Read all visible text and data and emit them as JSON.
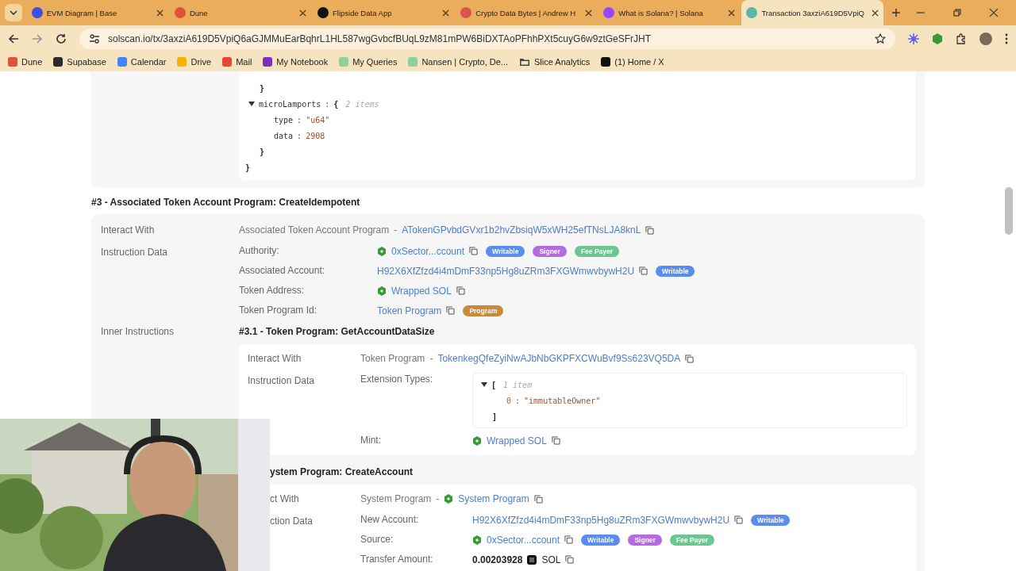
{
  "browser": {
    "tabs": [
      {
        "title": "EVM Diagram | Base",
        "selected": false,
        "color": "#3b4fe0"
      },
      {
        "title": "Dune",
        "selected": false,
        "color": "#e0533a"
      },
      {
        "title": "Flipside Data App",
        "selected": false,
        "color": "#111111"
      },
      {
        "title": "Crypto Data Bytes | Andrew H",
        "selected": false,
        "color": "#d9534f"
      },
      {
        "title": "What is Solana? | Solana",
        "selected": false,
        "color": "#9945ff"
      },
      {
        "title": "Transaction 3axziA619D5VpiQ",
        "selected": true,
        "color": "#5fb3a8"
      }
    ],
    "url": "solscan.io/tx/3axziA619D5VpiQ6aGJMMuEarBqhrL1HL587wgGvbcfBUqL9zM81mPW6BiDXTAoPFhhPXt5cuyG6w9ztGeSFrJHT",
    "bookmarks": [
      {
        "label": "Dune",
        "kind": "site",
        "color": "#e0533a"
      },
      {
        "label": "Supabase",
        "kind": "site",
        "color": "#2b2b2b"
      },
      {
        "label": "Calendar",
        "kind": "site",
        "color": "#4285f4"
      },
      {
        "label": "Drive",
        "kind": "site",
        "color": "#f4b400"
      },
      {
        "label": "Mail",
        "kind": "site",
        "color": "#ea4335"
      },
      {
        "label": "My Notebook",
        "kind": "site",
        "color": "#7b2fbf"
      },
      {
        "label": "My Queries",
        "kind": "site",
        "color": "#8fd19e"
      },
      {
        "label": "Nansen | Crypto, De...",
        "kind": "site",
        "color": "#8fd19e"
      },
      {
        "label": "Slice Analytics",
        "kind": "folder",
        "color": "#444444"
      },
      {
        "label": "(1) Home / X",
        "kind": "site",
        "color": "#111111"
      }
    ]
  },
  "code_tail": {
    "close": "}",
    "children": [
      {
        "close": "}"
      },
      {
        "key": "microLamports",
        "separator": ":",
        "open": "{",
        "close": "}",
        "count": "2 items",
        "expanded": true,
        "children": [
          {
            "key": "type",
            "separator": ":",
            "value": "\"u64\""
          },
          {
            "key": "data",
            "separator": ":",
            "value": "2908"
          }
        ]
      }
    ]
  },
  "section": {
    "title": "#3 - Associated Token Account Program: CreateIdempotent",
    "interact": {
      "label": "Interact With",
      "program": "Associated Token Account Program",
      "dash": "-",
      "address": "ATokenGPvbdGVxr1b2hvZbsiqW5xWH25efTNsLJA8knL",
      "verified": false
    },
    "data_label": "Instruction Data",
    "fields": [
      {
        "label": "Authority:",
        "kind": "link",
        "value": "0xSector...ccount",
        "verified": true,
        "badges": [
          {
            "label": "Writable",
            "color": "#5b8def"
          },
          {
            "label": "Signer",
            "color": "#b46ae0"
          },
          {
            "label": "Fee Payer",
            "color": "#6cc592"
          }
        ]
      },
      {
        "label": "Associated Account:",
        "kind": "link",
        "value": "H92X6XfZfzd4i4mDmF33np5Hg8uZRm3FXGWmwvbywH2U",
        "verified": false,
        "badges": [
          {
            "label": "Writable",
            "color": "#5b8def"
          }
        ]
      },
      {
        "label": "Token Address:",
        "kind": "link",
        "value": "Wrapped SOL",
        "verified": true
      },
      {
        "label": "Token Program Id:",
        "kind": "link",
        "value": "Token Program",
        "verified": false,
        "badges": [
          {
            "label": "Program",
            "color": "#c98a3a"
          }
        ]
      }
    ],
    "inner_label": "Inner Instructions",
    "inner": [
      {
        "title": "#3.1 - Token Program: GetAccountDataSize",
        "interact": {
          "label": "Interact With",
          "program": "Token Program",
          "dash": "-",
          "address": "TokenkegQfeZyiNwAJbNbGKPFXCWuBvf9Ss623VQ5DA",
          "verified": false
        },
        "data_label": "Instruction Data",
        "fields": [
          {
            "label": "Extension Types:",
            "kind": "json",
            "tree": {
              "open": "[",
              "close": "]",
              "count": "1 item",
              "expanded": true,
              "children": [
                {
                  "key": "0",
                  "separator": ":",
                  "value": "\"immutableOwner\""
                }
              ]
            }
          },
          {
            "label": "Mint:",
            "kind": "link",
            "value": "Wrapped SOL",
            "verified": true
          }
        ]
      },
      {
        "title": "ystem Program: CreateAccount",
        "interact": {
          "label": "ct With",
          "program": "System Program",
          "dash": "-",
          "address": "System Program",
          "verified": true
        },
        "data_label": "ction Data",
        "fields": [
          {
            "label": "New Account:",
            "kind": "link",
            "value": "H92X6XfZfzd4i4mDmF33np5Hg8uZRm3FXGWmwvbywH2U",
            "verified": false,
            "badges": [
              {
                "label": "Writable",
                "color": "#5b8def"
              }
            ]
          },
          {
            "label": "Source:",
            "kind": "link",
            "value": "0xSector...ccount",
            "verified": true,
            "badges": [
              {
                "label": "Writable",
                "color": "#5b8def"
              },
              {
                "label": "Signer",
                "color": "#b46ae0"
              },
              {
                "label": "Fee Payer",
                "color": "#6cc592"
              }
            ]
          },
          {
            "label": "Transfer Amount:",
            "kind": "amount",
            "value": "0.00203928",
            "token": "SOL"
          }
        ]
      }
    ]
  }
}
